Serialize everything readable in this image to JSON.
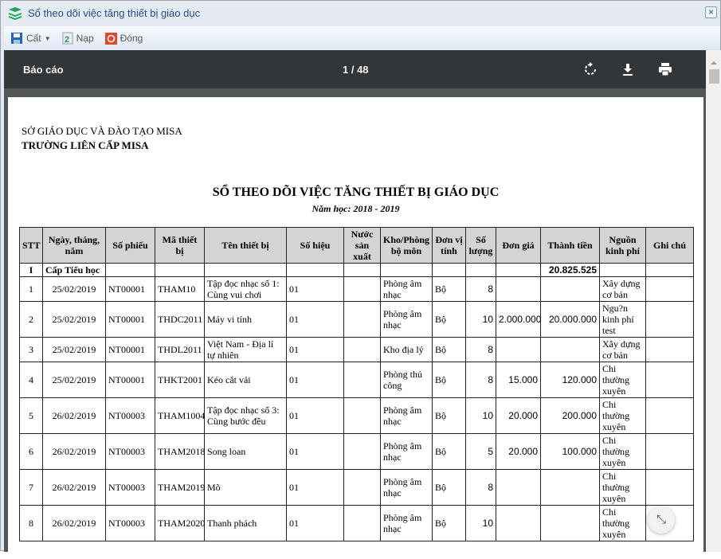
{
  "window": {
    "title": "Sổ theo dõi việc tăng thiết bị giáo dục",
    "close_icon": "×"
  },
  "toolbar": {
    "save": "Cất",
    "reload": "Nạp",
    "close": "Đóng"
  },
  "viewer": {
    "title": "Báo cáo",
    "page": "1 / 48"
  },
  "report": {
    "org": "SỞ GIÁO DỤC VÀ ĐÀO TẠO MISA",
    "school": "TRƯỜNG LIÊN CẤP MISA",
    "title": "SỔ THEO DÕI VIỆC TĂNG THIẾT BỊ GIÁO DỤC",
    "year": "Năm học: 2018 - 2019",
    "headers": [
      "STT",
      "Ngày, tháng, năm",
      "Số phiếu",
      "Mã thiết bị",
      "Tên thiết bị",
      "Số hiệu",
      "Nước sản xuất",
      "Kho/Phòng bộ môn",
      "Đơn vị tính",
      "Số lượng",
      "Đơn giá",
      "Thành tiền",
      "Nguồn kinh phí",
      "Ghi chú"
    ],
    "group": {
      "stt": "I",
      "name": "Cấp Tiểu học",
      "total": "20.825.525"
    },
    "rows": [
      [
        "1",
        "25/02/2019",
        "NT00001",
        "THAM10",
        "Tập đọc nhạc số 1: Cùng vui chơi",
        "01",
        "",
        "Phòng âm nhạc",
        "Bộ",
        "8",
        "",
        "",
        "Xây dựng cơ bản",
        ""
      ],
      [
        "2",
        "25/02/2019",
        "NT00001",
        "THDC2011",
        "Máy vi tính",
        "01",
        "",
        "Phòng âm nhạc",
        "Bộ",
        "10",
        "2.000.000",
        "20.000.000",
        "Ngu?n kinh phí test",
        ""
      ],
      [
        "3",
        "25/02/2019",
        "NT00001",
        "THDL2011",
        "Việt Nam - Địa lí tự nhiên",
        "01",
        "",
        "Kho địa lý",
        "Bộ",
        "8",
        "",
        "",
        "Xây dựng cơ bản",
        ""
      ],
      [
        "4",
        "25/02/2019",
        "NT00001",
        "THKT2001",
        "Kéo cắt vải",
        "01",
        "",
        "Phòng thủ công",
        "Bộ",
        "8",
        "15.000",
        "120.000",
        "Chi thường xuyên",
        ""
      ],
      [
        "5",
        "26/02/2019",
        "NT00003",
        "THAM1004",
        "Tập đọc nhạc số 3: Cùng bước đều",
        "01",
        "",
        "Phòng âm nhạc",
        "Bộ",
        "10",
        "20.000",
        "200.000",
        "Chi thường xuyên",
        ""
      ],
      [
        "6",
        "26/02/2019",
        "NT00003",
        "THAM2018",
        "Song loan",
        "01",
        "",
        "Phòng âm nhạc",
        "Bộ",
        "5",
        "20.000",
        "100.000",
        "Chi thường xuyên",
        ""
      ],
      [
        "7",
        "26/02/2019",
        "NT00003",
        "THAM2019",
        "Mõ",
        "01",
        "",
        "Phòng âm nhạc",
        "Bộ",
        "8",
        "",
        "",
        "Chi thường xuyên",
        ""
      ],
      [
        "8",
        "26/02/2019",
        "NT00003",
        "THAM2020",
        "Thanh phách",
        "01",
        "",
        "Phòng âm nhạc",
        "Bộ",
        "10",
        "",
        "",
        "Chi thường xuyên",
        ""
      ]
    ]
  }
}
